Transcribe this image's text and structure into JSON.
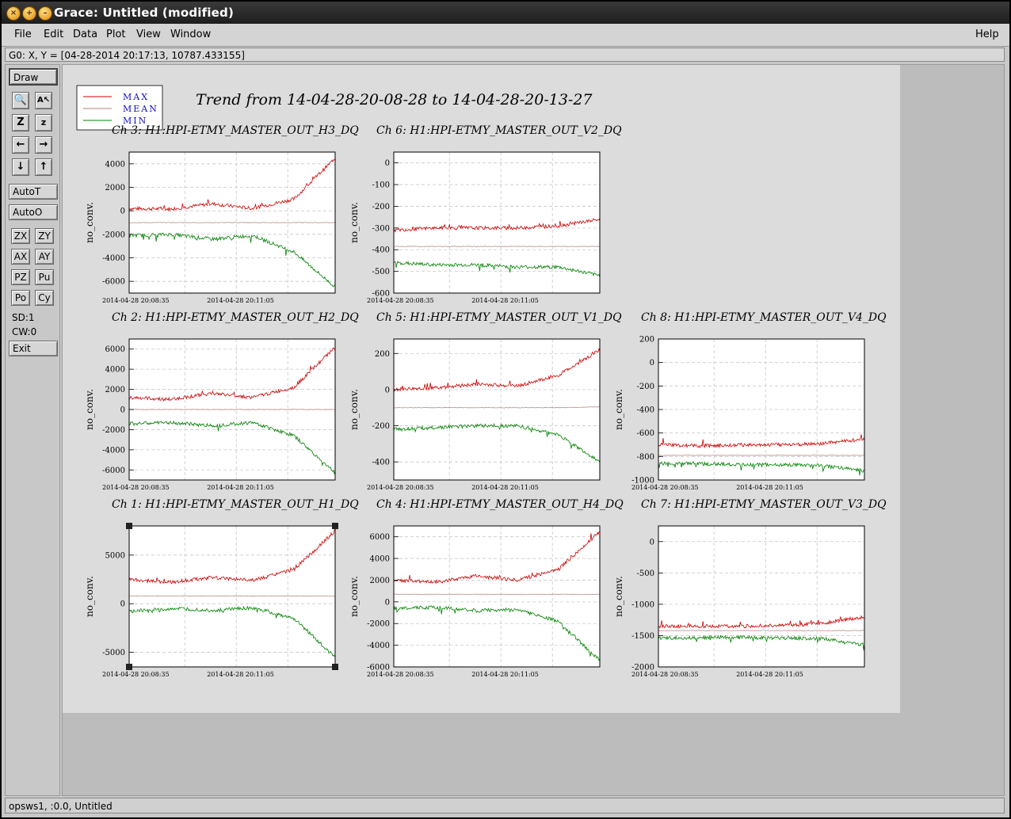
{
  "window": {
    "title": "Grace: Untitled (modified)"
  },
  "menu": {
    "file": "File",
    "edit": "Edit",
    "data": "Data",
    "plot": "Plot",
    "view": "View",
    "window": "Window",
    "help": "Help"
  },
  "locator": "G0: X, Y = [04-28-2014 20:17:13, 10787.433155]",
  "toolbar": {
    "draw": "Draw",
    "autot": "AutoT",
    "autoo": "AutoO",
    "zx": "ZX",
    "zy": "ZY",
    "ax": "AX",
    "ay": "AY",
    "pz": "PZ",
    "pu": "Pu",
    "po": "Po",
    "cy": "Cy",
    "sd": "SD:1",
    "cw": "CW:0",
    "exit": "Exit"
  },
  "status": "opsws1, :0.0, Untitled",
  "plot_title": "Trend from 14-04-28-20-08-28 to 14-04-28-20-13-27",
  "legend": [
    "MAX",
    "MEAN",
    "MIN"
  ],
  "colors": {
    "max": "#cc0000",
    "mean": "#b08080",
    "min": "#008000"
  },
  "ylabel": "no_conv.",
  "x_ticks": [
    "2014-04-28 20:08:35",
    "2014-04-28 20:11:05"
  ],
  "chart_data": [
    {
      "type": "line",
      "title": "Ch 3: H1:HPI-ETMY_MASTER_OUT_H3_DQ",
      "ylabel": "no_conv.",
      "ylim": [
        -7000,
        5000
      ],
      "yticks": [
        4000,
        2000,
        0,
        -2000,
        -4000,
        -6000
      ],
      "series": [
        {
          "name": "MAX",
          "values": [
            200,
            150,
            600,
            200,
            1000,
            4500
          ]
        },
        {
          "name": "MEAN",
          "values": [
            -1000,
            -1000,
            -1000,
            -1000,
            -1000,
            -1000
          ]
        },
        {
          "name": "MIN",
          "values": [
            -2100,
            -2000,
            -2400,
            -2100,
            -3500,
            -6500
          ]
        }
      ]
    },
    {
      "type": "line",
      "title": "Ch 6: H1:HPI-ETMY_MASTER_OUT_V2_DQ",
      "ylabel": "no_conv.",
      "ylim": [
        -600,
        50
      ],
      "yticks": [
        0,
        -100,
        -200,
        -300,
        -400,
        -500,
        -600
      ],
      "series": [
        {
          "name": "MAX",
          "values": [
            -310,
            -300,
            -300,
            -300,
            -290,
            -260
          ]
        },
        {
          "name": "MEAN",
          "values": [
            -385,
            -385,
            -385,
            -385,
            -385,
            -385
          ]
        },
        {
          "name": "MIN",
          "values": [
            -460,
            -470,
            -470,
            -480,
            -480,
            -520
          ]
        }
      ]
    },
    {
      "type": "line",
      "title": "Ch 2: H1:HPI-ETMY_MASTER_OUT_H2_DQ",
      "ylabel": "no_conv.",
      "ylim": [
        -7000,
        7000
      ],
      "yticks": [
        6000,
        4000,
        2000,
        0,
        -2000,
        -4000,
        -6000
      ],
      "series": [
        {
          "name": "MAX",
          "values": [
            1200,
            1000,
            1600,
            1200,
            2200,
            6200
          ]
        },
        {
          "name": "MEAN",
          "values": [
            0,
            0,
            0,
            0,
            0,
            0
          ]
        },
        {
          "name": "MIN",
          "values": [
            -1400,
            -1300,
            -1600,
            -1300,
            -2600,
            -6300
          ]
        }
      ]
    },
    {
      "type": "line",
      "title": "Ch 5: H1:HPI-ETMY_MASTER_OUT_V1_DQ",
      "ylabel": "no_conv.",
      "ylim": [
        -500,
        280
      ],
      "yticks": [
        200,
        0,
        -200,
        -400
      ],
      "series": [
        {
          "name": "MAX",
          "values": [
            0,
            10,
            30,
            20,
            80,
            220
          ]
        },
        {
          "name": "MEAN",
          "values": [
            -100,
            -100,
            -100,
            -100,
            -100,
            -95
          ]
        },
        {
          "name": "MIN",
          "values": [
            -220,
            -210,
            -200,
            -200,
            -250,
            -400
          ]
        }
      ]
    },
    {
      "type": "line",
      "title": "Ch 8: H1:HPI-ETMY_MASTER_OUT_V4_DQ",
      "ylabel": "no_conv.",
      "ylim": [
        -1000,
        200
      ],
      "yticks": [
        200,
        0,
        -200,
        -400,
        -600,
        -800,
        -1000
      ],
      "series": [
        {
          "name": "MAX",
          "values": [
            -700,
            -710,
            -700,
            -700,
            -690,
            -650
          ]
        },
        {
          "name": "MEAN",
          "values": [
            -790,
            -790,
            -790,
            -790,
            -790,
            -790
          ]
        },
        {
          "name": "MIN",
          "values": [
            -860,
            -860,
            -870,
            -870,
            -880,
            -920
          ]
        }
      ]
    },
    {
      "type": "line",
      "title": "Ch 1: H1:HPI-ETMY_MASTER_OUT_H1_DQ",
      "ylabel": "no_conv.",
      "ylim": [
        -6500,
        8000
      ],
      "yticks": [
        5000,
        0,
        -5000
      ],
      "series": [
        {
          "name": "MAX",
          "values": [
            2500,
            2200,
            2700,
            2400,
            3500,
            7500
          ]
        },
        {
          "name": "MEAN",
          "values": [
            800,
            800,
            800,
            800,
            800,
            800
          ]
        },
        {
          "name": "MIN",
          "values": [
            -800,
            -500,
            -700,
            -400,
            -1500,
            -5500
          ]
        }
      ]
    },
    {
      "type": "line",
      "title": "Ch 4: H1:HPI-ETMY_MASTER_OUT_H4_DQ",
      "ylabel": "no_conv.",
      "ylim": [
        -6000,
        7000
      ],
      "yticks": [
        6000,
        4000,
        2000,
        0,
        -2000,
        -4000,
        -6000
      ],
      "series": [
        {
          "name": "MAX",
          "values": [
            2000,
            1800,
            2400,
            2000,
            3000,
            6500
          ]
        },
        {
          "name": "MEAN",
          "values": [
            700,
            700,
            700,
            700,
            700,
            700
          ]
        },
        {
          "name": "MIN",
          "values": [
            -600,
            -500,
            -800,
            -700,
            -1800,
            -5400
          ]
        }
      ]
    },
    {
      "type": "line",
      "title": "Ch 7: H1:HPI-ETMY_MASTER_OUT_V3_DQ",
      "ylabel": "no_conv.",
      "ylim": [
        -2000,
        250
      ],
      "yticks": [
        0,
        -500,
        -1000,
        -1500,
        -2000
      ],
      "series": [
        {
          "name": "MAX",
          "values": [
            -1350,
            -1350,
            -1350,
            -1340,
            -1300,
            -1200
          ]
        },
        {
          "name": "MEAN",
          "values": [
            -1420,
            -1420,
            -1420,
            -1420,
            -1420,
            -1420
          ]
        },
        {
          "name": "MIN",
          "values": [
            -1540,
            -1530,
            -1530,
            -1540,
            -1550,
            -1650
          ]
        }
      ]
    }
  ]
}
